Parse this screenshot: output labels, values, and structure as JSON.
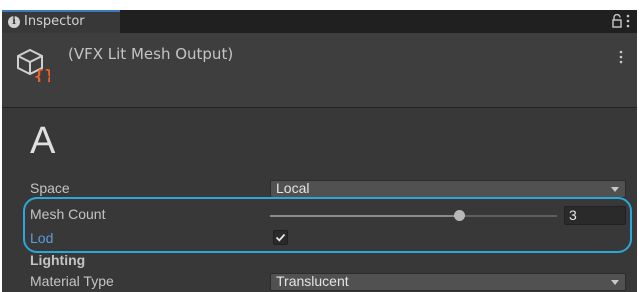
{
  "tab": {
    "label": "Inspector",
    "icon": "info-icon"
  },
  "tab_actions": [
    "lock-icon",
    "kebab-menu-icon"
  ],
  "header": {
    "title": "(VFX Lit Mesh Output)",
    "icon": "vfx-cube-icon",
    "menu_icon": "kebab-menu-icon"
  },
  "section": {
    "heading": "A"
  },
  "properties": {
    "space": {
      "label": "Space",
      "value": "Local"
    },
    "mesh_count": {
      "label": "Mesh Count",
      "value": "3",
      "slider_fraction": 0.66
    },
    "lod": {
      "label": "Lod",
      "checked": true
    },
    "lighting_heading": "Lighting",
    "material_type": {
      "label": "Material Type",
      "value": "Translucent"
    }
  },
  "colors": {
    "panel_bg": "#383838",
    "header_bg": "#3e3e3e",
    "highlight": "#2ba7da",
    "lod_label": "#5f9be0",
    "icon_accent": "#e85f2a"
  }
}
